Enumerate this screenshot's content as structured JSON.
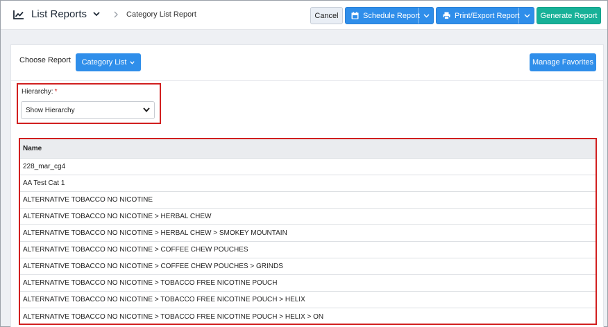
{
  "header": {
    "title": "List Reports",
    "breadcrumb": "Category List Report",
    "buttons": {
      "cancel": "Cancel",
      "schedule": "Schedule Report",
      "print_export": "Print/Export Report",
      "generate": "Generate Report"
    }
  },
  "choose_report": {
    "label": "Choose Report",
    "selected": "Category List",
    "manage_favorites": "Manage Favorites"
  },
  "hierarchy": {
    "label": "Hierarchy:",
    "required_mark": "*",
    "value": "Show Hierarchy"
  },
  "table": {
    "columns": [
      "Name"
    ],
    "rows": [
      "228_mar_cg4",
      "AA Test Cat 1",
      "ALTERNATIVE TOBACCO NO NICOTINE",
      "ALTERNATIVE TOBACCO NO NICOTINE > HERBAL CHEW",
      "ALTERNATIVE TOBACCO NO NICOTINE > HERBAL CHEW > SMOKEY MOUNTAIN",
      "ALTERNATIVE TOBACCO NO NICOTINE > COFFEE CHEW POUCHES",
      "ALTERNATIVE TOBACCO NO NICOTINE > COFFEE CHEW POUCHES > GRINDS",
      "ALTERNATIVE TOBACCO NO NICOTINE > TOBACCO FREE NICOTINE POUCH",
      "ALTERNATIVE TOBACCO NO NICOTINE > TOBACCO FREE NICOTINE POUCH > HELIX",
      "ALTERNATIVE TOBACCO NO NICOTINE > TOBACCO FREE NICOTINE POUCH > HELIX > ON"
    ]
  },
  "icons": {
    "title": "chart-line-icon",
    "schedule": "calendar-icon",
    "print": "printer-icon"
  },
  "colors": {
    "primary": "#2f8eea",
    "generate": "#17b198",
    "highlight": "#d11f1f"
  }
}
